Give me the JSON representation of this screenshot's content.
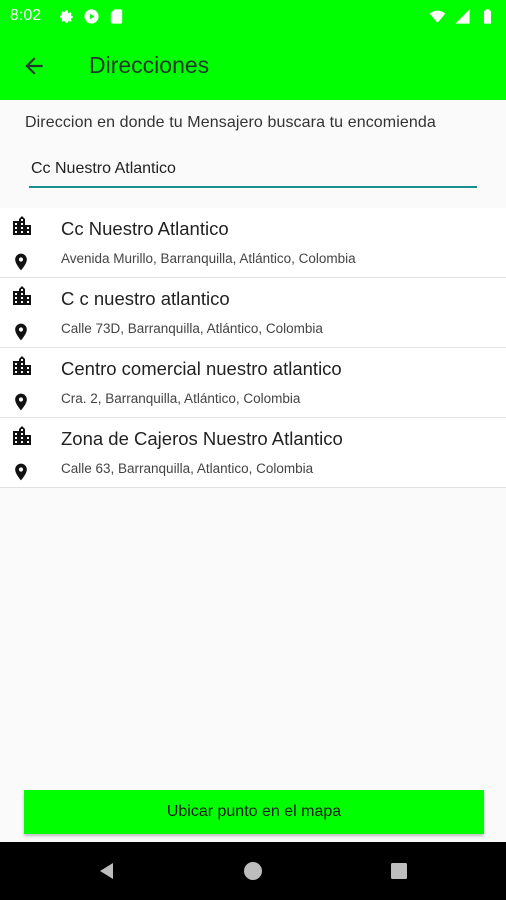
{
  "status_bar": {
    "time": "8:02",
    "left_icons": [
      "settings-icon",
      "play-protect-icon",
      "sd-card-icon"
    ],
    "right_icons": [
      "wifi-icon",
      "cell-signal-icon",
      "battery-icon"
    ]
  },
  "app_bar": {
    "title": "Direcciones",
    "back_icon": "arrow-back-icon",
    "color": "#00ff00"
  },
  "instruction": "Direccion en donde tu Mensajero buscara tu encomienda",
  "search": {
    "value": "Cc Nuestro Atlantico",
    "underline_color": "#1a8f8f"
  },
  "results": [
    {
      "name": "Cc Nuestro Atlantico",
      "address": "Avenida Murillo, Barranquilla, Atlántico, Colombia"
    },
    {
      "name": "C c nuestro atlantico",
      "address": "Calle 73D, Barranquilla, Atlántico, Colombia"
    },
    {
      "name": "Centro comercial nuestro atlantico",
      "address": "Cra. 2, Barranquilla, Atlántico, Colombia"
    },
    {
      "name": "Zona de Cajeros Nuestro Atlantico",
      "address": "Calle 63, Barranquilla, Atlantico, Colombia"
    }
  ],
  "map_button": {
    "label": "Ubicar punto en el mapa"
  },
  "nav_bar": {
    "buttons": [
      "back-triangle-icon",
      "home-circle-icon",
      "recents-square-icon"
    ]
  }
}
